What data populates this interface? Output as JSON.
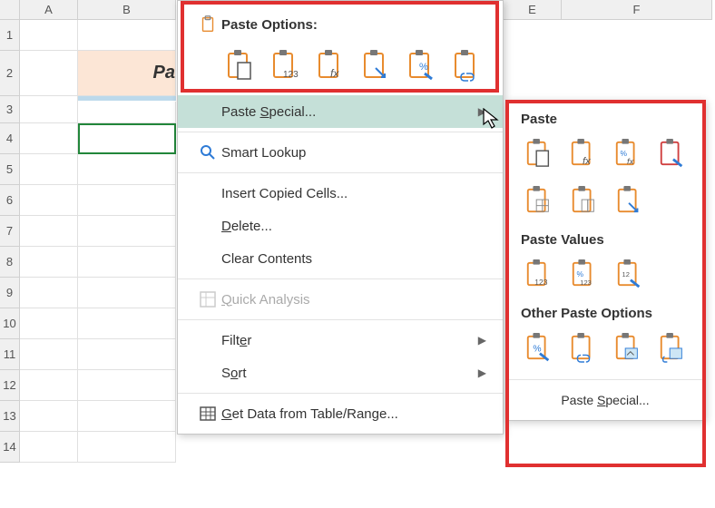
{
  "grid": {
    "columns": [
      "A",
      "B",
      "E",
      "F"
    ],
    "rows": [
      "1",
      "2",
      "3",
      "4",
      "5",
      "6",
      "7",
      "8",
      "9",
      "10",
      "11",
      "12",
      "13",
      "14"
    ],
    "b2_value": "Pa",
    "col_widths": {
      "A": 64,
      "B": 108,
      "gap": 384,
      "E": 64,
      "F": 166
    }
  },
  "menu": {
    "paste_options_label": "Paste Options:",
    "paste_special": "Paste Special...",
    "smart_lookup": "Smart Lookup",
    "insert_copied": "Insert Copied Cells...",
    "delete": "Delete...",
    "clear_contents": "Clear Contents",
    "quick_analysis": "Quick Analysis",
    "filter": "Filter",
    "sort": "Sort",
    "get_data": "Get Data from Table/Range..."
  },
  "submenu": {
    "paste_header": "Paste",
    "paste_values_header": "Paste Values",
    "other_options_header": "Other Paste Options",
    "paste_special": "Paste Special..."
  },
  "icons": {
    "main_row": [
      "paste",
      "values",
      "formulas",
      "transpose",
      "formatting",
      "link"
    ],
    "sub_paste_row1": [
      "paste",
      "formulas",
      "formulas-num",
      "source-fmt"
    ],
    "sub_paste_row2": [
      "no-borders",
      "col-width",
      "transpose"
    ],
    "sub_values_row": [
      "values",
      "values-num",
      "values-fmt"
    ],
    "sub_other_row": [
      "formatting",
      "link",
      "picture",
      "linked-picture"
    ]
  }
}
